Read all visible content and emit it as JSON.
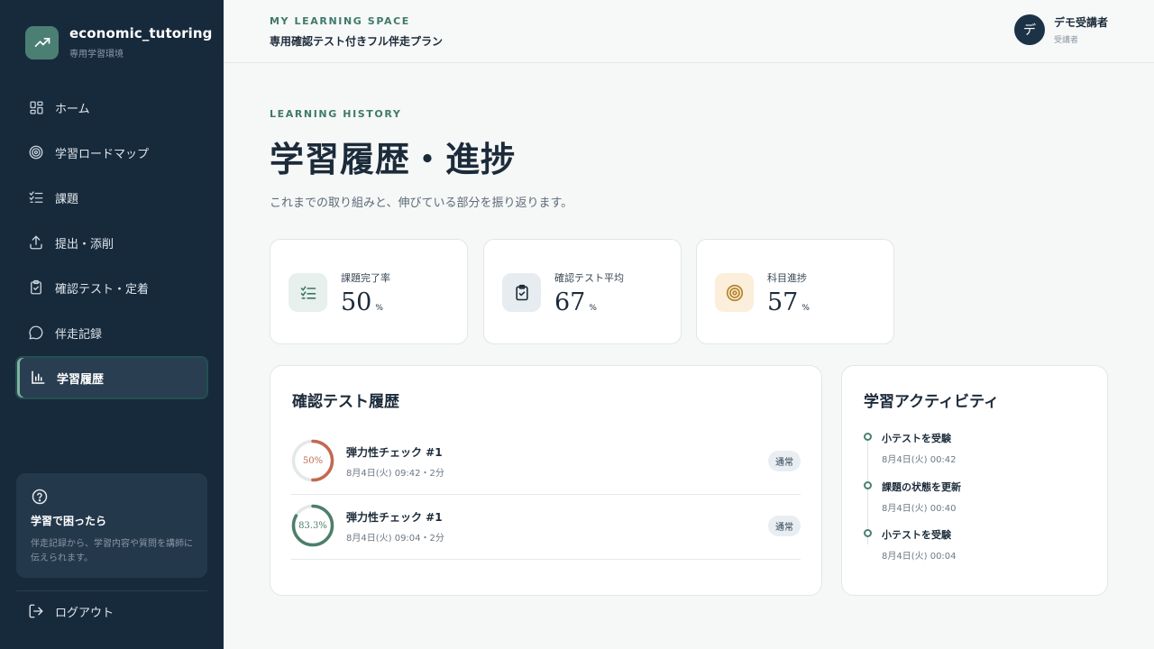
{
  "sidebar": {
    "brand_name": "economic_tutoring",
    "brand_sub": "専用学習環境",
    "items": [
      {
        "label": "ホーム",
        "icon": "home-grid-icon"
      },
      {
        "label": "学習ロードマップ",
        "icon": "target-icon"
      },
      {
        "label": "課題",
        "icon": "checklist-icon"
      },
      {
        "label": "提出・添削",
        "icon": "upload-icon"
      },
      {
        "label": "確認テスト・定着",
        "icon": "clipboard-check-icon"
      },
      {
        "label": "伴走記録",
        "icon": "chat-bubble-icon"
      },
      {
        "label": "学習履歴",
        "icon": "bar-chart-icon",
        "active": true
      }
    ],
    "help": {
      "title": "学習で困ったら",
      "text": "伴走記録から、学習内容や質問を講師に伝えられます。"
    },
    "logout_label": "ログアウト"
  },
  "header": {
    "eyebrow": "MY LEARNING SPACE",
    "plan": "専用確認テスト付きフル伴走プラン",
    "user_initial": "デ",
    "user_name": "デモ受講者",
    "user_role": "受講者"
  },
  "main": {
    "eyebrow": "LEARNING HISTORY",
    "title": "学習履歴・進捗",
    "description": "これまでの取り組みと、伸びている部分を振り返ります。",
    "stats": [
      {
        "label": "課題完了率",
        "value": "50",
        "unit": "%",
        "icon": "checklist-icon",
        "color": "#e7f0ec"
      },
      {
        "label": "確認テスト平均",
        "value": "67",
        "unit": "%",
        "icon": "clipboard-check-icon",
        "color": "#e6ecf0"
      },
      {
        "label": "科目進捗",
        "value": "57",
        "unit": "%",
        "icon": "target-icon",
        "color": "#fbeedb"
      }
    ],
    "test_history": {
      "title": "確認テスト履歴",
      "rows": [
        {
          "score": "50%",
          "score_value": 50,
          "name": "弾力性チェック #1",
          "meta": "8月4日(火) 09:42・2分",
          "badge": "通常",
          "color": "#c2694f"
        },
        {
          "score": "83.3%",
          "score_value": 83.3,
          "name": "弾力性チェック #1",
          "meta": "8月4日(火) 09:04・2分",
          "badge": "通常",
          "color": "#4c7f6a"
        }
      ]
    },
    "activity": {
      "title": "学習アクティビティ",
      "items": [
        {
          "title": "小テストを受験",
          "time": "8月4日(火) 00:42"
        },
        {
          "title": "課題の状態を更新",
          "time": "8月4日(火) 00:40"
        },
        {
          "title": "小テストを受験",
          "time": "8月4日(火) 00:04"
        }
      ]
    }
  }
}
